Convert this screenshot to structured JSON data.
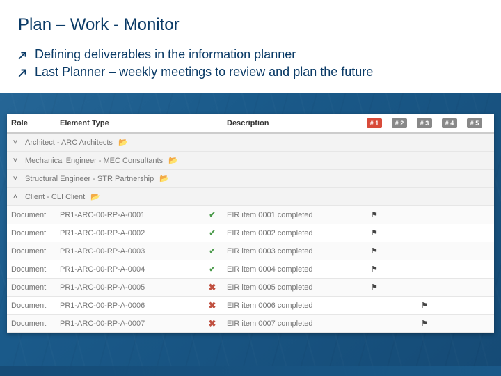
{
  "title": "Plan – Work - Monitor",
  "bullets": [
    "Defining deliverables in the information planner",
    "Last Planner – weekly meetings to review and plan the future"
  ],
  "headers": {
    "role": "Role",
    "element_type": "Element Type",
    "description": "Description",
    "columns": [
      "# 1",
      "# 2",
      "# 3",
      "# 4",
      "# 5"
    ],
    "active_col": 0
  },
  "groups": [
    {
      "expanded": false,
      "label": "Architect - ARC Architects"
    },
    {
      "expanded": false,
      "label": "Mechanical Engineer - MEC Consultants"
    },
    {
      "expanded": false,
      "label": "Structural Engineer - STR Partnership"
    },
    {
      "expanded": true,
      "label": "Client - CLI Client"
    }
  ],
  "rows": [
    {
      "role": "Document",
      "elem": "PR1-ARC-00-RP-A-0001",
      "status": "check",
      "desc": "EIR item 0001 completed",
      "flags": [
        true,
        false,
        false,
        false,
        false
      ]
    },
    {
      "role": "Document",
      "elem": "PR1-ARC-00-RP-A-0002",
      "status": "check",
      "desc": "EIR item 0002 completed",
      "flags": [
        true,
        false,
        false,
        false,
        false
      ]
    },
    {
      "role": "Document",
      "elem": "PR1-ARC-00-RP-A-0003",
      "status": "check",
      "desc": "EIR item 0003 completed",
      "flags": [
        true,
        false,
        false,
        false,
        false
      ]
    },
    {
      "role": "Document",
      "elem": "PR1-ARC-00-RP-A-0004",
      "status": "check",
      "desc": "EIR item 0004 completed",
      "flags": [
        true,
        false,
        false,
        false,
        false
      ]
    },
    {
      "role": "Document",
      "elem": "PR1-ARC-00-RP-A-0005",
      "status": "cross",
      "desc": "EIR item 0005 completed",
      "flags": [
        true,
        false,
        false,
        false,
        false
      ]
    },
    {
      "role": "Document",
      "elem": "PR1-ARC-00-RP-A-0006",
      "status": "cross",
      "desc": "EIR item 0006 completed",
      "flags": [
        false,
        false,
        true,
        false,
        false
      ]
    },
    {
      "role": "Document",
      "elem": "PR1-ARC-00-RP-A-0007",
      "status": "cross",
      "desc": "EIR item 0007 completed",
      "flags": [
        false,
        false,
        true,
        false,
        false
      ]
    }
  ],
  "icons": {
    "arrow": "↗",
    "chev_down": "˅",
    "chev_up": "˄",
    "folder": "📂",
    "check": "✔",
    "cross": "✖",
    "flag": "⚑"
  }
}
